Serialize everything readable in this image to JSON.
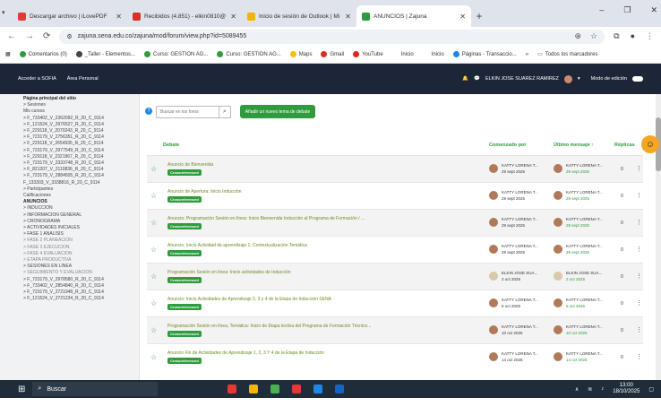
{
  "browser": {
    "tabs": [
      {
        "label": "Descargar archivo | iLovePDF",
        "color": "#e53935"
      },
      {
        "label": "Recibidos (4.851) - elkin0810@",
        "color": "#d93025"
      },
      {
        "label": "Inicio de sesión de Outlook | Mi",
        "color": "#f4b400"
      },
      {
        "label": "ANUNCIOS | Zajuna",
        "color": "#2e9b3c"
      }
    ],
    "url": "zajuna.sena.edu.co/zajuna/mod/forum/view.php?id=5089455",
    "bookmarks": [
      {
        "label": "Comentarios (0)",
        "color": "#2e9b3c"
      },
      {
        "label": "_Taller - Elementos...",
        "color": "#444"
      },
      {
        "label": "Curso: GESTION AG...",
        "color": "#2e9b3c"
      },
      {
        "label": "Curso: GESTION AG...",
        "color": "#2e9b3c"
      },
      {
        "label": "Maps",
        "color": "#fbbc05"
      },
      {
        "label": "Gmail",
        "color": "#d93025"
      },
      {
        "label": "YouTube",
        "color": "#e62117"
      },
      {
        "label": "Inicio",
        "color": "#fff"
      },
      {
        "label": "Inicio",
        "color": "#fff"
      },
      {
        "label": "Páginas - Transaccio...",
        "color": "#1e88e5"
      }
    ],
    "bookmarks_more": "»",
    "all_bookmarks": "Todos los marcadores"
  },
  "header": {
    "left_links": [
      "Acceder a SOFIA",
      "Área Personal"
    ],
    "user_name": "ELKIN JOSE SUAREZ RAMIREZ",
    "edit_mode": "Modo de edición"
  },
  "sidebar": {
    "items": [
      {
        "label": "Página principal del sitio",
        "type": "bold"
      },
      {
        "label": "> Sesiones",
        "type": ""
      },
      {
        "label": "Mis cursos",
        "type": ""
      },
      {
        "label": "> F_733402_V_2362092_R_20_C_9114",
        "type": ""
      },
      {
        "label": "> F_121524_V_2976527_R_20_C_9114",
        "type": ""
      },
      {
        "label": "> F_229118_V_2070243_R_20_C_9114",
        "type": ""
      },
      {
        "label": "> F_723179_V_2756351_R_20_C_9114",
        "type": ""
      },
      {
        "label": "> F_229118_V_2654935_R_20_C_9114",
        "type": ""
      },
      {
        "label": "> F_723179_V_2977549_R_20_C_9114",
        "type": ""
      },
      {
        "label": "> F_229118_V_2321967_R_20_C_9114",
        "type": ""
      },
      {
        "label": "> F_723179_V_2333748_R_20_C_9114",
        "type": ""
      },
      {
        "label": "> F_821207_V_2110836_R_20_C_9114",
        "type": ""
      },
      {
        "label": "> F_723179_V_2884505_R_20_C_9114",
        "type": ""
      },
      {
        "label": "F_133303_V_3338816_R_20_C_9114",
        "type": ""
      },
      {
        "label": "> Participantes",
        "type": ""
      },
      {
        "label": "Calificaciones",
        "type": ""
      },
      {
        "label": "ANUNCIOS",
        "type": "bold"
      },
      {
        "label": "> INDUCCION",
        "type": ""
      },
      {
        "label": "> INFORMACIÓN GENERAL",
        "type": ""
      },
      {
        "label": "> CRONOGRAMA",
        "type": ""
      },
      {
        "label": "> ACTIVIDADES INICIALES",
        "type": ""
      },
      {
        "label": "> FASE 1 ANÁLISIS",
        "type": ""
      },
      {
        "label": "> FASE 2 PLANEACIÓN",
        "type": "dim"
      },
      {
        "label": "> FASE 3 EJECUCIÓN",
        "type": "dim"
      },
      {
        "label": "> FASE 4 EVALUACIÓN",
        "type": "dim"
      },
      {
        "label": "> ETAPA PRODUCTIVA",
        "type": "dim"
      },
      {
        "label": "> SESIONES EN LÍNEA",
        "type": ""
      },
      {
        "label": "> SEGUIMIENTO Y EVALUACIÓN",
        "type": "dim"
      },
      {
        "label": "> F_723179_V_2978580_R_20_C_9114",
        "type": ""
      },
      {
        "label": "> F_733402_V_2854840_R_20_C_9114",
        "type": ""
      },
      {
        "label": "> F_723179_V_2721948_R_20_C_9114",
        "type": ""
      },
      {
        "label": "> F_121524_V_2721234_R_20_C_9114",
        "type": ""
      }
    ]
  },
  "forum": {
    "search_placeholder": "Buscar en los foros",
    "add_topic": "Añadir un nuevo tema de debate",
    "columns": {
      "debate": "Debate",
      "started_by": "Comenzado por",
      "last_post": "Último mensaje ↑",
      "replies": "Réplicas"
    },
    "badge": "Crossreferenced",
    "rows": [
      {
        "title": "Anuncio de Bienvenida",
        "author": "KATTY LORENA T...",
        "date": "29 sept 2025",
        "last": "KATTY LORENA T...",
        "last_date": "29 sept 2025",
        "replies": "0"
      },
      {
        "title": "Anuncio de Apertura: Inicio Inducción",
        "author": "KATTY LORENA T...",
        "date": "29 sept 2025",
        "last": "KATTY LORENA T...",
        "last_date": "29 sept 2025",
        "replies": "0"
      },
      {
        "title": "Anuncio: Programación Sesión en línea: Inicio Bienvenida Inducción al Programa de Formación / ...",
        "author": "KATTY LORENA T...",
        "date": "29 sept 2025",
        "last": "KATTY LORENA T...",
        "last_date": "29 sept 2025",
        "replies": "0"
      },
      {
        "title": "Anuncio: Inicio Actividad de aprendizaje 1: Contextualización Temática",
        "author": "KATTY LORENA T...",
        "date": "29 sept 2025",
        "last": "KATTY LORENA T...",
        "last_date": "29 sept 2025",
        "replies": "0"
      },
      {
        "title": "Programación Sesión en línea: Inicio actividades de Inducción",
        "author": "ELKIN JOSE SUA...",
        "date": "2 oct 2025",
        "last": "ELKIN JOSE SUA...",
        "last_date": "2 oct 2025",
        "replies": "0"
      },
      {
        "title": "Anuncio: Inicio Actividades de Aprendizaje 2, 3 y 4 de la Etapa de Inducción SENA",
        "author": "KATTY LORENA T...",
        "date": "6 oct 2025",
        "last": "KATTY LORENA T...",
        "last_date": "6 oct 2025",
        "replies": "0"
      },
      {
        "title": "Programación Sesión en línea, Temática: Inicio de Etapa lectiva del Programa de Formación Técnico...",
        "author": "KATTY LORENA T...",
        "date": "10 oct 2025",
        "last": "KATTY LORENA T...",
        "last_date": "10 oct 2025",
        "replies": "0"
      },
      {
        "title": "Anuncio Fin de Actividades de Aprendizaje 1, 2, 3 Y 4 de la Etapa de Inducción",
        "author": "KATTY LORENA T...",
        "date": "14 oct 2025",
        "last": "KATTY LORENA T...",
        "last_date": "14 oct 2025",
        "replies": "0"
      }
    ]
  },
  "taskbar": {
    "search": "Buscar",
    "time": "13:00",
    "date": "18/10/2025"
  }
}
